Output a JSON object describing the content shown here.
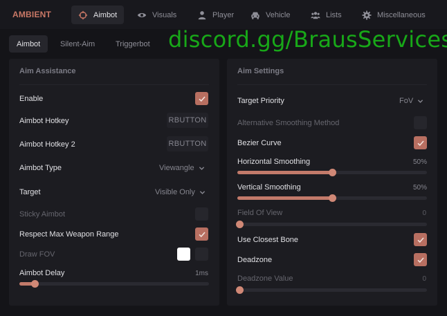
{
  "app": {
    "brand": "AMBIENT",
    "watermark": "discord.gg/BrausServices"
  },
  "nav_tabs": [
    {
      "label": "Aimbot",
      "icon": "crosshair-icon",
      "active": true
    },
    {
      "label": "Visuals",
      "icon": "eye-icon"
    },
    {
      "label": "Player",
      "icon": "user-icon"
    },
    {
      "label": "Vehicle",
      "icon": "car-icon"
    },
    {
      "label": "Lists",
      "icon": "users-icon"
    },
    {
      "label": "Miscellaneous",
      "icon": "gear-icon"
    }
  ],
  "sub_tabs": [
    {
      "label": "Aimbot",
      "active": true
    },
    {
      "label": "Silent-Aim"
    },
    {
      "label": "Triggerbot"
    }
  ],
  "aim_assistance": {
    "title": "Aim Assistance",
    "enable": {
      "label": "Enable",
      "checked": true
    },
    "hotkey": {
      "label": "Aimbot Hotkey",
      "value": "RBUTTON"
    },
    "hotkey2": {
      "label": "Aimbot Hotkey 2",
      "value": "RBUTTON"
    },
    "type": {
      "label": "Aimbot Type",
      "value": "Viewangle"
    },
    "target": {
      "label": "Target",
      "value": "Visible Only"
    },
    "sticky": {
      "label": "Sticky Aimbot",
      "checked": false
    },
    "respect_range": {
      "label": "Respect Max Weapon Range",
      "checked": true
    },
    "draw_fov": {
      "label": "Draw FOV",
      "checked": false,
      "color": "#ffffff"
    },
    "delay": {
      "label": "Aimbot Delay",
      "value": "1ms",
      "fraction": 0.08
    }
  },
  "aim_settings": {
    "title": "Aim Settings",
    "priority": {
      "label": "Target Priority",
      "value": "FoV"
    },
    "alt_smoothing": {
      "label": "Alternative Smoothing Method",
      "checked": false
    },
    "bezier": {
      "label": "Bezier Curve",
      "checked": true
    },
    "h_smooth": {
      "label": "Horizontal Smoothing",
      "value": "50%",
      "fraction": 0.5
    },
    "v_smooth": {
      "label": "Vertical Smoothing",
      "value": "50%",
      "fraction": 0.5
    },
    "fov": {
      "label": "Field Of View",
      "value": "0",
      "fraction": 0
    },
    "closest_bone": {
      "label": "Use Closest Bone",
      "checked": true
    },
    "deadzone": {
      "label": "Deadzone",
      "checked": true
    },
    "deadzone_value": {
      "label": "Deadzone Value",
      "value": "0",
      "fraction": 0
    }
  },
  "colors": {
    "accent": "#b86f61",
    "slider": "#c27a6a",
    "watermark": "#18a818"
  }
}
